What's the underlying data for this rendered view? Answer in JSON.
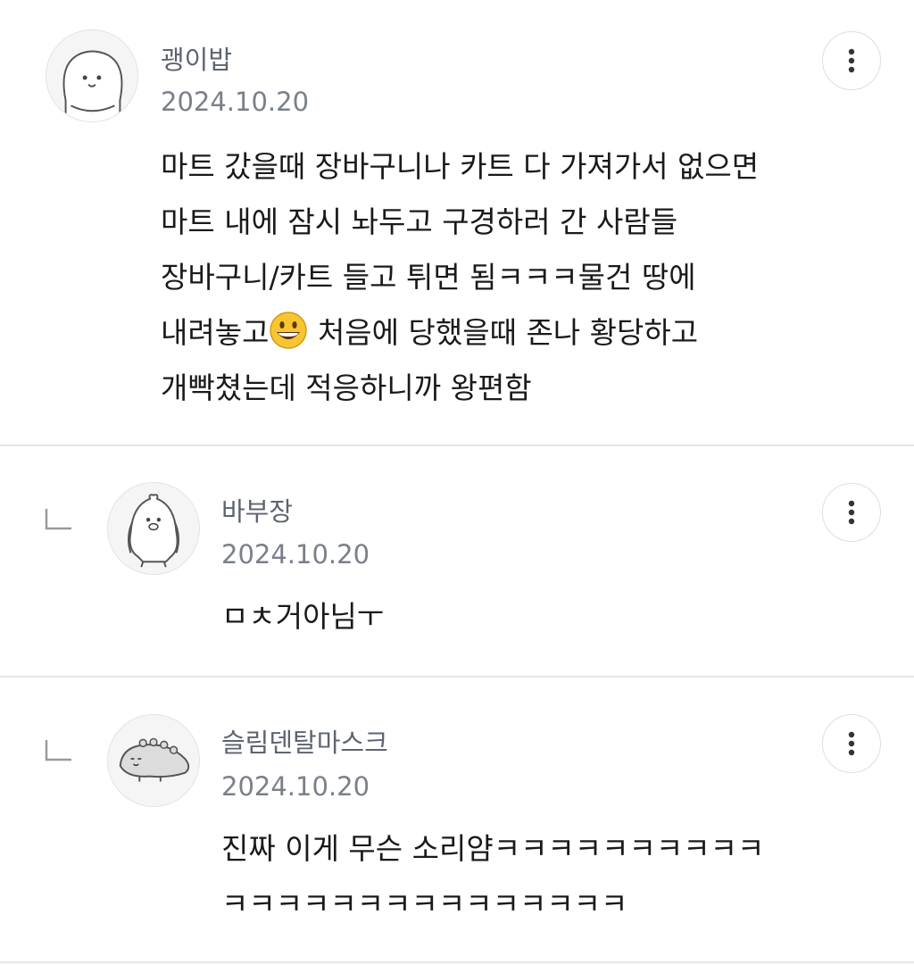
{
  "comments": [
    {
      "nickname": "괭이밥",
      "date": "2024.10.20",
      "lines": [
        "마트 갔을때 장바구니나 카트 다 가져가서 없으면",
        "마트 내에 잠시 놔두고 구경하러 간 사람들",
        "장바구니/카트 들고 튀면 됨ㅋㅋㅋ물건 땅에"
      ],
      "line4_before": "내려놓고",
      "line4_after": " 처음에 당했을때 존나 황당하고",
      "line5": "개빡쳤는데 적응하니까 왕편함",
      "more_icon": "more-vertical-icon"
    },
    {
      "nickname": "바부장",
      "date": "2024.10.20",
      "lines": [
        "ㅁㅊ거아님ㅜ"
      ],
      "more_icon": "more-vertical-icon"
    },
    {
      "nickname": "슬림덴탈마스크",
      "date": "2024.10.20",
      "lines": [
        "진짜 이게 무슨 소리얌ㅋㅋㅋㅋㅋㅋㅋㅋㅋㅋ",
        "ㅋㅋㅋㅋㅋㅋㅋㅋㅋㅋㅋㅋㅋㅋㅋ"
      ],
      "more_icon": "more-vertical-icon"
    }
  ],
  "colors": {
    "nickname": "#5c6470",
    "date": "#7a808a",
    "divider": "#e6e6e6",
    "emoji": "#f7c531"
  },
  "icons": {
    "reply": "reply-corner-icon",
    "emoji": "grinning-face-emoji"
  }
}
